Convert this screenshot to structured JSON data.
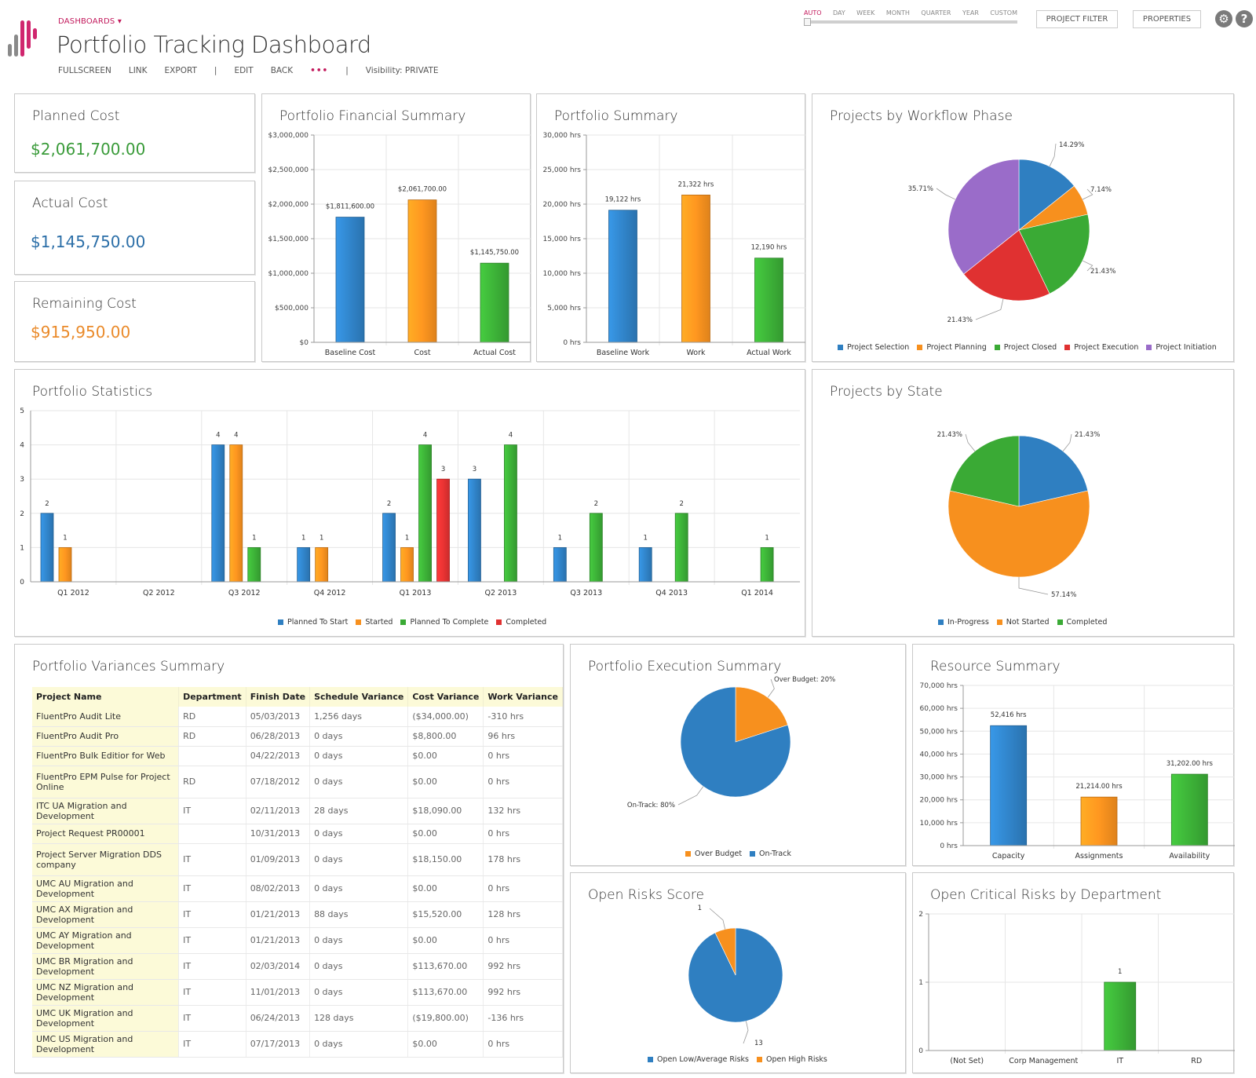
{
  "header": {
    "breadcrumb": "DASHBOARDS ▾",
    "title": "Portfolio Tracking Dashboard",
    "actions": [
      "FULLSCREEN",
      "LINK",
      "EXPORT",
      "|",
      "EDIT",
      "BACK",
      "•••",
      "|",
      "Visibility: PRIVATE"
    ],
    "timescale": {
      "options": [
        "AUTO",
        "DAY",
        "WEEK",
        "MONTH",
        "QUARTER",
        "YEAR",
        "CUSTOM"
      ],
      "selected": "AUTO"
    },
    "project_filter_label": "PROJECT FILTER",
    "properties_label": "PROPERTIES",
    "settings_icon": "gear-icon",
    "help_icon": "help-icon",
    "help_glyph": "?",
    "settings_glyph": "⚙",
    "accent": "#c2185b"
  },
  "colors": {
    "blue": "#2f7fc1",
    "orange": "#f7901e",
    "green": "#3aaa35",
    "red": "#e03131",
    "purple": "#9a6cc9",
    "kpi_green": "#3a9b3a",
    "kpi_blue": "#2c6fa8",
    "kpi_orange": "#ea8a2a"
  },
  "kpis": [
    {
      "label": "Planned Cost",
      "value": "$2,061,700.00",
      "color": "green"
    },
    {
      "label": "Actual Cost",
      "value": "$1,145,750.00",
      "color": "blue"
    },
    {
      "label": "Remaining Cost",
      "value": "$915,950.00",
      "color": "orange"
    }
  ],
  "panels": {
    "financial": "Portfolio Financial Summary",
    "summary": "Portfolio Summary",
    "workflow": "Projects by Workflow Phase",
    "statistics": "Portfolio Statistics",
    "state": "Projects by State",
    "variances": "Portfolio Variances Summary",
    "execution": "Portfolio Execution Summary",
    "resource": "Resource Summary",
    "risks": "Open Risks Score",
    "critical": "Open Critical Risks by Department"
  },
  "chart_data": [
    {
      "id": "financial",
      "type": "bar",
      "title": "Portfolio Financial Summary",
      "categories": [
        "Baseline Cost",
        "Cost",
        "Actual Cost"
      ],
      "values": [
        1811600,
        2061700,
        1145750
      ],
      "labels": [
        "$1,811,600.00",
        "$2,061,700.00",
        "$1,145,750.00"
      ],
      "colors": [
        "blue",
        "orange",
        "green"
      ],
      "yticks": [
        "$0",
        "$500,000",
        "$1,000,000",
        "$1,500,000",
        "$2,000,000",
        "$2,500,000",
        "$3,000,000"
      ],
      "ylim": [
        0,
        3000000
      ],
      "grid": true
    },
    {
      "id": "summary",
      "type": "bar",
      "title": "Portfolio Summary",
      "categories": [
        "Baseline Work",
        "Work",
        "Actual Work"
      ],
      "values": [
        19122,
        21322,
        12190
      ],
      "labels": [
        "19,122 hrs",
        "21,322 hrs",
        "12,190 hrs"
      ],
      "colors": [
        "blue",
        "orange",
        "green"
      ],
      "yticks": [
        "0 hrs",
        "5,000 hrs",
        "10,000 hrs",
        "15,000 hrs",
        "20,000 hrs",
        "25,000 hrs",
        "30,000 hrs"
      ],
      "ylim": [
        0,
        30000
      ],
      "grid": true
    },
    {
      "id": "workflow",
      "type": "pie",
      "title": "Projects by Workflow Phase",
      "slices": [
        {
          "name": "Project Selection",
          "value": 14.29,
          "label": "14.29%",
          "color": "blue"
        },
        {
          "name": "Project Planning",
          "value": 7.14,
          "label": "7.14%",
          "color": "orange"
        },
        {
          "name": "Project Closed",
          "value": 21.43,
          "label": "21.43%",
          "color": "green"
        },
        {
          "name": "Project Execution",
          "value": 21.43,
          "label": "21.43%",
          "color": "red"
        },
        {
          "name": "Project Initiation",
          "value": 35.71,
          "label": "35.71%",
          "color": "purple"
        }
      ],
      "legend": "bottom"
    },
    {
      "id": "statistics",
      "type": "bar",
      "title": "Portfolio Statistics",
      "categories": [
        "Q1 2012",
        "Q2 2012",
        "Q3 2012",
        "Q4 2012",
        "Q1 2013",
        "Q2 2013",
        "Q3 2013",
        "Q4 2013",
        "Q1 2014"
      ],
      "series": [
        {
          "name": "Planned To Start",
          "color": "blue",
          "values": [
            2,
            0,
            4,
            1,
            2,
            3,
            1,
            1,
            0
          ]
        },
        {
          "name": "Started",
          "color": "orange",
          "values": [
            1,
            0,
            4,
            1,
            1,
            0,
            0,
            0,
            0
          ]
        },
        {
          "name": "Planned To Complete",
          "color": "green",
          "values": [
            0,
            0,
            1,
            0,
            4,
            4,
            2,
            2,
            1
          ]
        },
        {
          "name": "Completed",
          "color": "red",
          "values": [
            0,
            0,
            0,
            0,
            3,
            0,
            0,
            0,
            0
          ]
        }
      ],
      "yticks": [
        "0",
        "1",
        "2",
        "3",
        "4",
        "5"
      ],
      "ylim": [
        0,
        5
      ],
      "grid": true,
      "legend": "bottom"
    },
    {
      "id": "state",
      "type": "pie",
      "title": "Projects by State",
      "slices": [
        {
          "name": "In-Progress",
          "value": 21.43,
          "label": "21.43%",
          "color": "blue"
        },
        {
          "name": "Not Started",
          "value": 57.14,
          "label": "57.14%",
          "color": "orange"
        },
        {
          "name": "Completed",
          "value": 21.43,
          "label": "21.43%",
          "color": "green"
        }
      ],
      "legend": "bottom"
    },
    {
      "id": "execution",
      "type": "pie",
      "title": "Portfolio Execution Summary",
      "slices": [
        {
          "name": "Over Budget",
          "value": 20,
          "label": "Over Budget: 20%",
          "color": "orange"
        },
        {
          "name": "On-Track",
          "value": 80,
          "label": "On-Track: 80%",
          "color": "blue"
        }
      ],
      "legend": "bottom"
    },
    {
      "id": "resource",
      "type": "bar",
      "title": "Resource Summary",
      "categories": [
        "Capacity",
        "Assignments",
        "Availability"
      ],
      "values": [
        52416,
        21214,
        31202
      ],
      "labels": [
        "52,416 hrs",
        "21,214.00 hrs",
        "31,202.00 hrs"
      ],
      "colors": [
        "blue",
        "orange",
        "green"
      ],
      "yticks": [
        "0 hrs",
        "10,000 hrs",
        "20,000 hrs",
        "30,000 hrs",
        "40,000 hrs",
        "50,000 hrs",
        "60,000 hrs",
        "70,000 hrs"
      ],
      "ylim": [
        0,
        70000
      ],
      "grid": true
    },
    {
      "id": "risks",
      "type": "pie",
      "title": "Open Risks Score",
      "slices": [
        {
          "name": "Open High Risks",
          "value": 1,
          "label": "1",
          "color": "orange"
        },
        {
          "name": "Open Low/Average Risks",
          "value": 13,
          "label": "13",
          "color": "blue"
        }
      ],
      "legend_order": [
        "Open Low/Average Risks",
        "Open High Risks"
      ],
      "legend": "bottom"
    },
    {
      "id": "critical",
      "type": "bar",
      "title": "Open Critical Risks by Department",
      "categories": [
        "(Not Set)",
        "Corp Management",
        "IT",
        "RD"
      ],
      "values": [
        0,
        0,
        1,
        0
      ],
      "labels": [
        "",
        "",
        "1",
        ""
      ],
      "colors": [
        "green",
        "green",
        "green",
        "green"
      ],
      "yticks": [
        "0",
        "1",
        "2"
      ],
      "ylim": [
        0,
        2
      ],
      "grid": true
    }
  ],
  "variances_table": {
    "columns": [
      "Project Name",
      "Department",
      "Finish Date",
      "Schedule Variance",
      "Cost Variance",
      "Work Variance"
    ],
    "rows": [
      [
        "FluentPro Audit Lite",
        "RD",
        "05/03/2013",
        "1,256 days",
        "($34,000.00)",
        "-310 hrs"
      ],
      [
        "FluentPro Audit Pro",
        "RD",
        "06/28/2013",
        "0 days",
        "$8,800.00",
        "96 hrs"
      ],
      [
        "FluentPro Bulk Editior for Web",
        "",
        "04/22/2013",
        "0 days",
        "$0.00",
        "0 hrs"
      ],
      [
        "FluentPro EPM Pulse for Project Online",
        "RD",
        "07/18/2012",
        "0 days",
        "$0.00",
        "0 hrs"
      ],
      [
        "ITC UA Migration and Development",
        "IT",
        "02/11/2013",
        "28 days",
        "$18,090.00",
        "132 hrs"
      ],
      [
        "Project Request PR00001",
        "",
        "10/31/2013",
        "0 days",
        "$0.00",
        "0 hrs"
      ],
      [
        "Project Server Migration DDS company",
        "IT",
        "01/09/2013",
        "0 days",
        "$18,150.00",
        "178 hrs"
      ],
      [
        "UMC AU Migration and Development",
        "IT",
        "08/02/2013",
        "0 days",
        "$0.00",
        "0 hrs"
      ],
      [
        "UMC AX Migration and Development",
        "IT",
        "01/21/2013",
        "88 days",
        "$15,520.00",
        "128 hrs"
      ],
      [
        "UMC AY Migration and Development",
        "IT",
        "01/21/2013",
        "0 days",
        "$0.00",
        "0 hrs"
      ],
      [
        "UMC BR Migration and Development",
        "IT",
        "02/03/2014",
        "0 days",
        "$113,670.00",
        "992 hrs"
      ],
      [
        "UMC NZ Migration and Development",
        "IT",
        "11/01/2013",
        "0 days",
        "$113,670.00",
        "992 hrs"
      ],
      [
        "UMC UK Migration and Development",
        "IT",
        "06/24/2013",
        "128 days",
        "($19,800.00)",
        "-136 hrs"
      ],
      [
        "UMC US Migration and Development",
        "IT",
        "07/17/2013",
        "0 days",
        "$0.00",
        "0 hrs"
      ]
    ]
  }
}
